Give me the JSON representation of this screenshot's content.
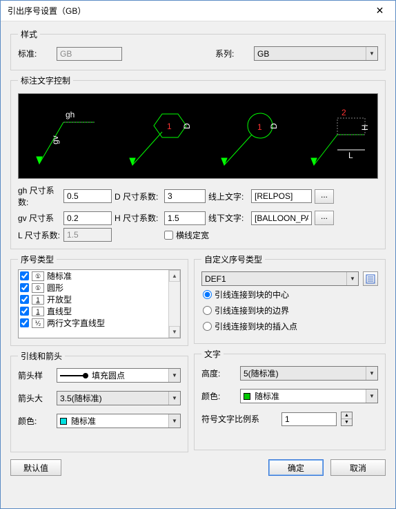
{
  "title": "引出序号设置（GB）",
  "style": {
    "legend": "样式",
    "standard_label": "标准:",
    "standard_value": "GB",
    "series_label": "系列:",
    "series_value": "GB"
  },
  "textctrl": {
    "legend": "标注文字控制",
    "gh_label": "gh 尺寸系数:",
    "gh_value": "0.5",
    "gv_label": "gv 尺寸系",
    "gv_value": "0.2",
    "l_label": "L 尺寸系数:",
    "l_value": "1.5",
    "d_label": "D 尺寸系数:",
    "d_value": "3",
    "h_label": "H 尺寸系数:",
    "h_value": "1.5",
    "hline_label": "横线定宽",
    "online_label": "线上文字:",
    "online_value": "[RELPOS]",
    "under_label": "线下文字:",
    "under_value": "[BALLOON_PART",
    "dots": "..."
  },
  "seqtype": {
    "legend": "序号类型",
    "items": [
      {
        "icon": "①",
        "label": "随标准",
        "checked": true
      },
      {
        "icon": "①",
        "label": "圆形",
        "checked": true
      },
      {
        "icon": "1",
        "label": "开放型",
        "checked": true,
        "underline": true
      },
      {
        "icon": "1",
        "label": "直线型",
        "checked": true,
        "underline": true
      },
      {
        "icon": "⅟₂",
        "label": "两行文字直线型",
        "checked": true
      }
    ]
  },
  "custom": {
    "legend": "自定义序号类型",
    "combo": "DEF1",
    "radios": [
      "引线连接到块的中心",
      "引线连接到块的边界",
      "引线连接到块的插入点"
    ]
  },
  "leader": {
    "legend": "引线和箭头",
    "style_label": "箭头样",
    "style_value": "填充圆点",
    "size_label": "箭头大",
    "size_value": "3.5(随标准)",
    "color_label": "颜色:",
    "color_value": "随标准",
    "color_swatch": "#00E0E0"
  },
  "text": {
    "legend": "文字",
    "height_label": "高度:",
    "height_value": "5(随标准)",
    "color_label": "颜色:",
    "color_value": "随标准",
    "color_swatch": "#00C800",
    "ratio_label": "符号文字比例系",
    "ratio_value": "1"
  },
  "buttons": {
    "default": "默认值",
    "ok": "确定",
    "cancel": "取消"
  }
}
